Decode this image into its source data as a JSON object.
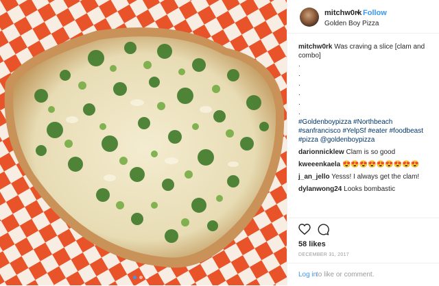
{
  "header": {
    "username": "mitchw0rk",
    "separator": "•",
    "follow_label": "Follow",
    "location": "Golden Boy Pizza"
  },
  "caption": {
    "username": "mitchw0rk",
    "text": "Was craving a slice [clam and combo]",
    "dots": [
      ".",
      ".",
      ".",
      ".",
      ".",
      "."
    ],
    "hashtags": "#Goldenboypizza #Northbeach #sanfrancisco #YelpSf #eater #foodbeast #pizza @goldenboypizza"
  },
  "comments": [
    {
      "username": "darionnicklew",
      "text": "Clam is so good"
    },
    {
      "username": "kweeenkaela",
      "text": "😍😍😍😍😍😍😍😍😍"
    },
    {
      "username": "j_an_jello",
      "text": "Yesss! I always get the clam!"
    },
    {
      "username": "dylanwong24",
      "text": "Looks bombastic"
    }
  ],
  "actions": {
    "like_icon": "heart-icon",
    "comment_icon": "comment-icon",
    "likes": "58 likes",
    "date": "DECEMBER 31, 2017"
  },
  "login": {
    "link": "Log in",
    "text": "to like or comment."
  },
  "carousel": {
    "count": 3,
    "active": 1
  },
  "colors": {
    "accent": "#3897f0",
    "hashtag": "#003569",
    "muted": "#999999",
    "checker_red": "#e8532a"
  }
}
